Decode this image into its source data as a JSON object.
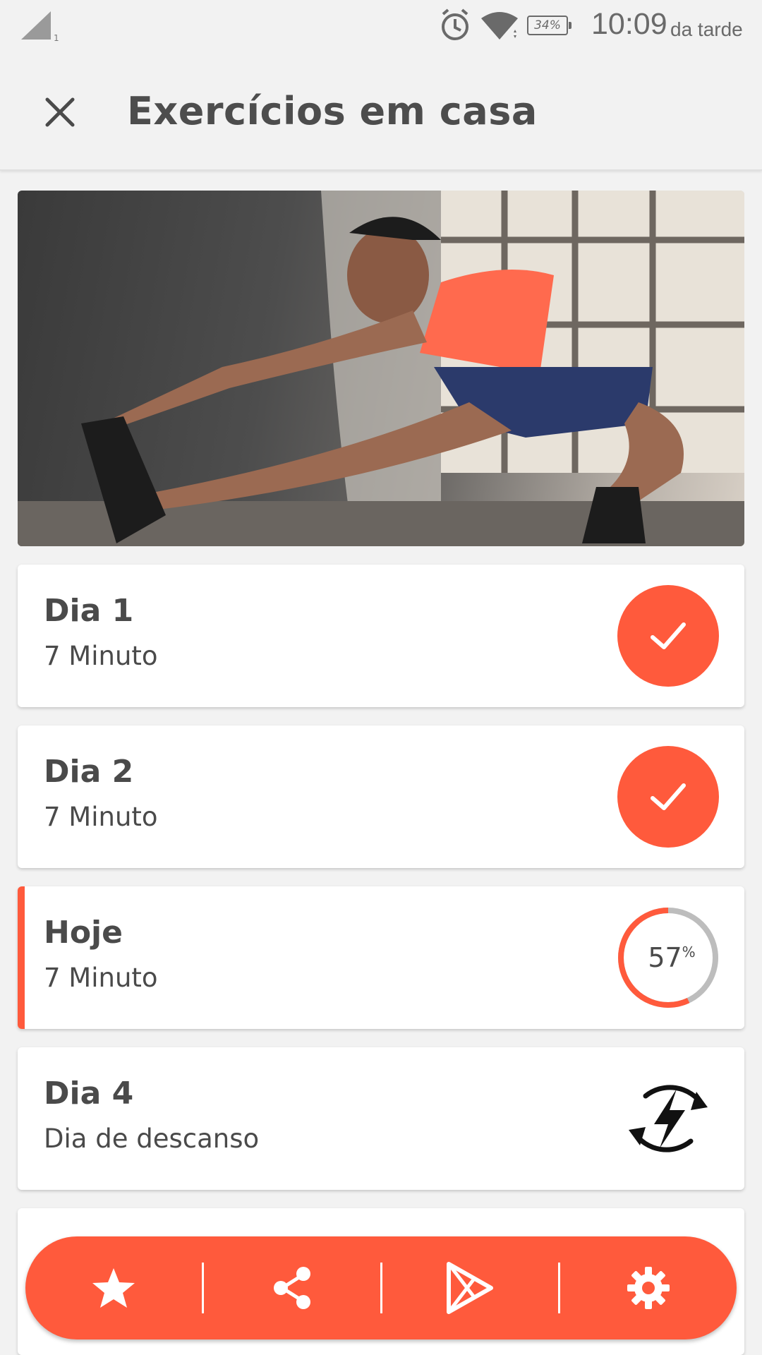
{
  "status_bar": {
    "battery": "34%",
    "time": "10:09",
    "period": "da tarde",
    "icons": [
      "signal-icon",
      "alarm-icon",
      "wifi-icon",
      "battery-icon"
    ]
  },
  "app_bar": {
    "title": "Exercícios em casa",
    "close_icon": "close-icon"
  },
  "hero": {
    "image": "woman-stretching-photo"
  },
  "days": [
    {
      "title": "Dia 1",
      "subtitle": "7 Minuto",
      "status": "completed"
    },
    {
      "title": "Dia 2",
      "subtitle": "7 Minuto",
      "status": "completed"
    },
    {
      "title": "Hoje",
      "subtitle": "7 Minuto",
      "status": "in-progress",
      "progress_value": "57",
      "progress_unit": "%",
      "progress_fraction": 0.57
    },
    {
      "title": "Dia 4",
      "subtitle": "Dia de descanso",
      "status": "rest"
    }
  ],
  "bottom_bar": {
    "buttons": [
      "star-icon",
      "share-icon",
      "play-store-icon",
      "gear-icon"
    ]
  },
  "colors": {
    "accent": "#ff5a3c",
    "background": "#f2f2f2",
    "card": "#ffffff",
    "text": "#4a4a4a",
    "progress_track": "#bdbdbd"
  }
}
